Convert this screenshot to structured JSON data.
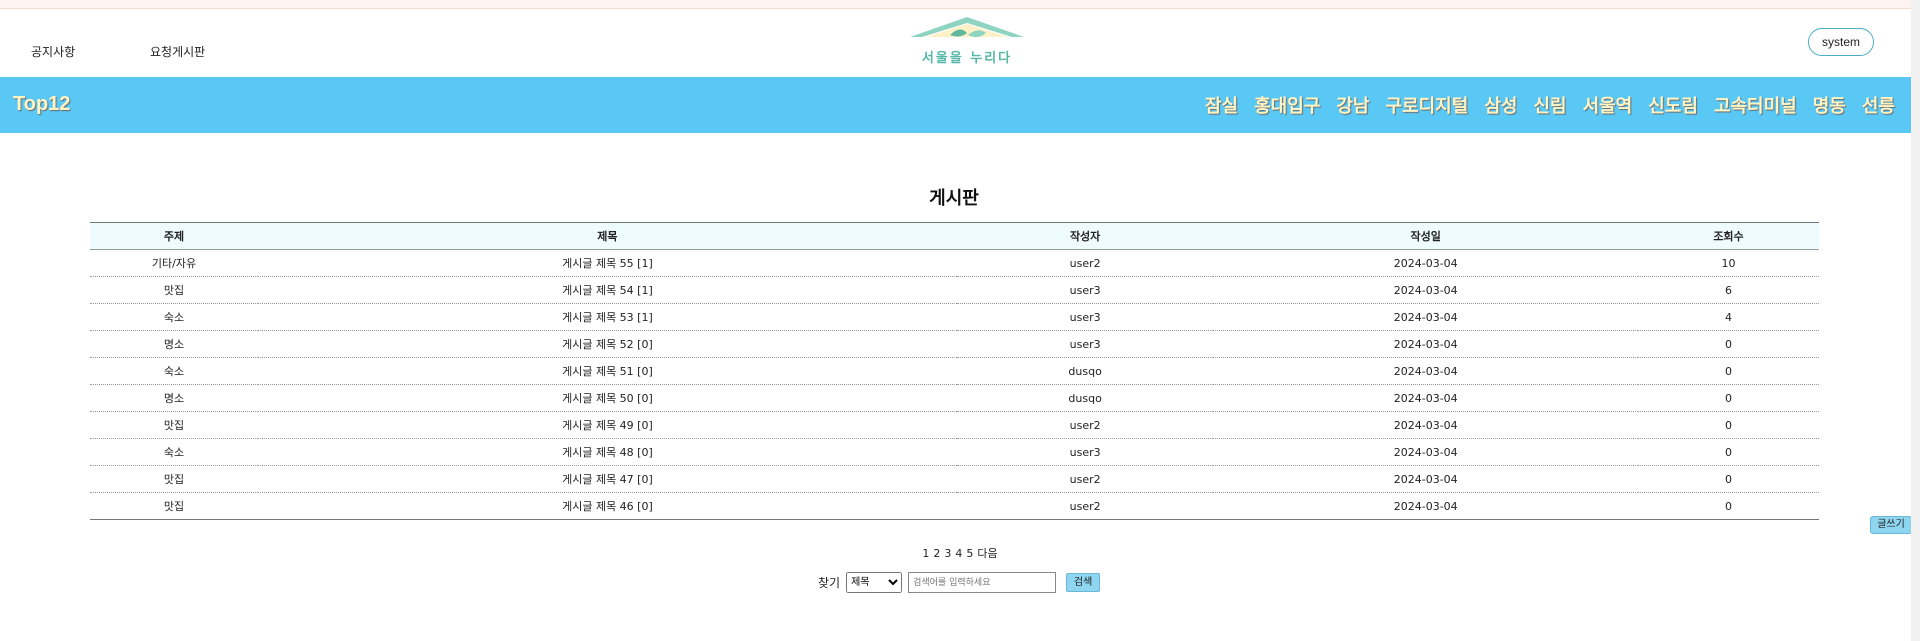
{
  "header": {
    "links": [
      "공지사항",
      "요청게시판"
    ],
    "logo_text": "서울을 누리다",
    "user_button": "system"
  },
  "navbar": {
    "brand": "Top12",
    "items": [
      "잠실",
      "홍대입구",
      "강남",
      "구로디지털",
      "삼성",
      "신림",
      "서울역",
      "신도림",
      "고속터미널",
      "명동",
      "선릉"
    ]
  },
  "board": {
    "title": "게시판",
    "columns": [
      "주제",
      "제목",
      "작성자",
      "작성일",
      "조회수"
    ],
    "rows": [
      [
        "기타/자유",
        "게시글 제목 55 [1]",
        "user2",
        "2024-03-04",
        "10"
      ],
      [
        "맛집",
        "게시글 제목 54 [1]",
        "user3",
        "2024-03-04",
        "6"
      ],
      [
        "숙소",
        "게시글 제목 53 [1]",
        "user3",
        "2024-03-04",
        "4"
      ],
      [
        "명소",
        "게시글 제목 52 [0]",
        "user3",
        "2024-03-04",
        "0"
      ],
      [
        "숙소",
        "게시글 제목 51 [0]",
        "dusqo",
        "2024-03-04",
        "0"
      ],
      [
        "명소",
        "게시글 제목 50 [0]",
        "dusqo",
        "2024-03-04",
        "0"
      ],
      [
        "맛집",
        "게시글 제목 49 [0]",
        "user2",
        "2024-03-04",
        "0"
      ],
      [
        "숙소",
        "게시글 제목 48 [0]",
        "user3",
        "2024-03-04",
        "0"
      ],
      [
        "맛집",
        "게시글 제목 47 [0]",
        "user2",
        "2024-03-04",
        "0"
      ],
      [
        "맛집",
        "게시글 제목 46 [0]",
        "user2",
        "2024-03-04",
        "0"
      ]
    ],
    "write_button": "글쓰기"
  },
  "pagination": {
    "pages": [
      "1",
      "2",
      "3",
      "4",
      "5"
    ],
    "next": "다음"
  },
  "search": {
    "label": "찾기",
    "selected_option": "제목",
    "placeholder": "검색어를 입력하세요",
    "button": "검색"
  }
}
